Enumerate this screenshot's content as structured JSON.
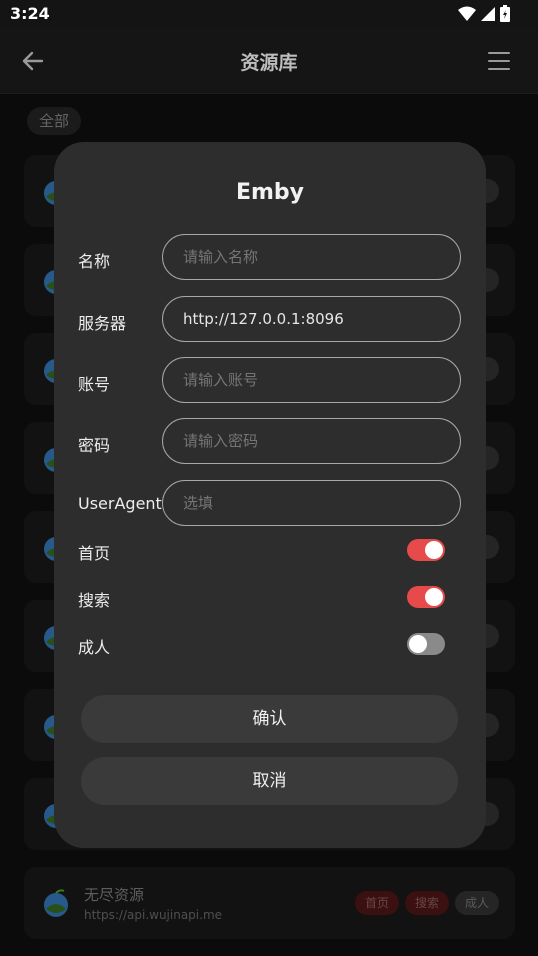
{
  "status_bar": {
    "time": "3:24"
  },
  "app_bar": {
    "title": "资源库"
  },
  "filter": {
    "all_label": "全部"
  },
  "list": {
    "visible_card": {
      "name": "无尽资源",
      "url": "https://api.wujinapi.me",
      "tags": [
        "首页",
        "搜索",
        "成人"
      ]
    }
  },
  "dialog": {
    "title": "Emby",
    "fields": [
      {
        "label": "名称",
        "value": "",
        "placeholder": "请输入名称"
      },
      {
        "label": "服务器",
        "value": "http://127.0.0.1:8096",
        "placeholder": ""
      },
      {
        "label": "账号",
        "value": "",
        "placeholder": "请输入账号"
      },
      {
        "label": "密码",
        "value": "",
        "placeholder": "请输入密码"
      },
      {
        "label": "UserAgent",
        "value": "",
        "placeholder": "选填"
      }
    ],
    "switches": [
      {
        "label": "首页",
        "on": true
      },
      {
        "label": "搜索",
        "on": true
      },
      {
        "label": "成人",
        "on": false
      }
    ],
    "confirm_label": "确认",
    "cancel_label": "取消"
  },
  "colors": {
    "accent": "#e64a4a",
    "dialog_bg": "#2d2d2d",
    "background": "#121212"
  }
}
